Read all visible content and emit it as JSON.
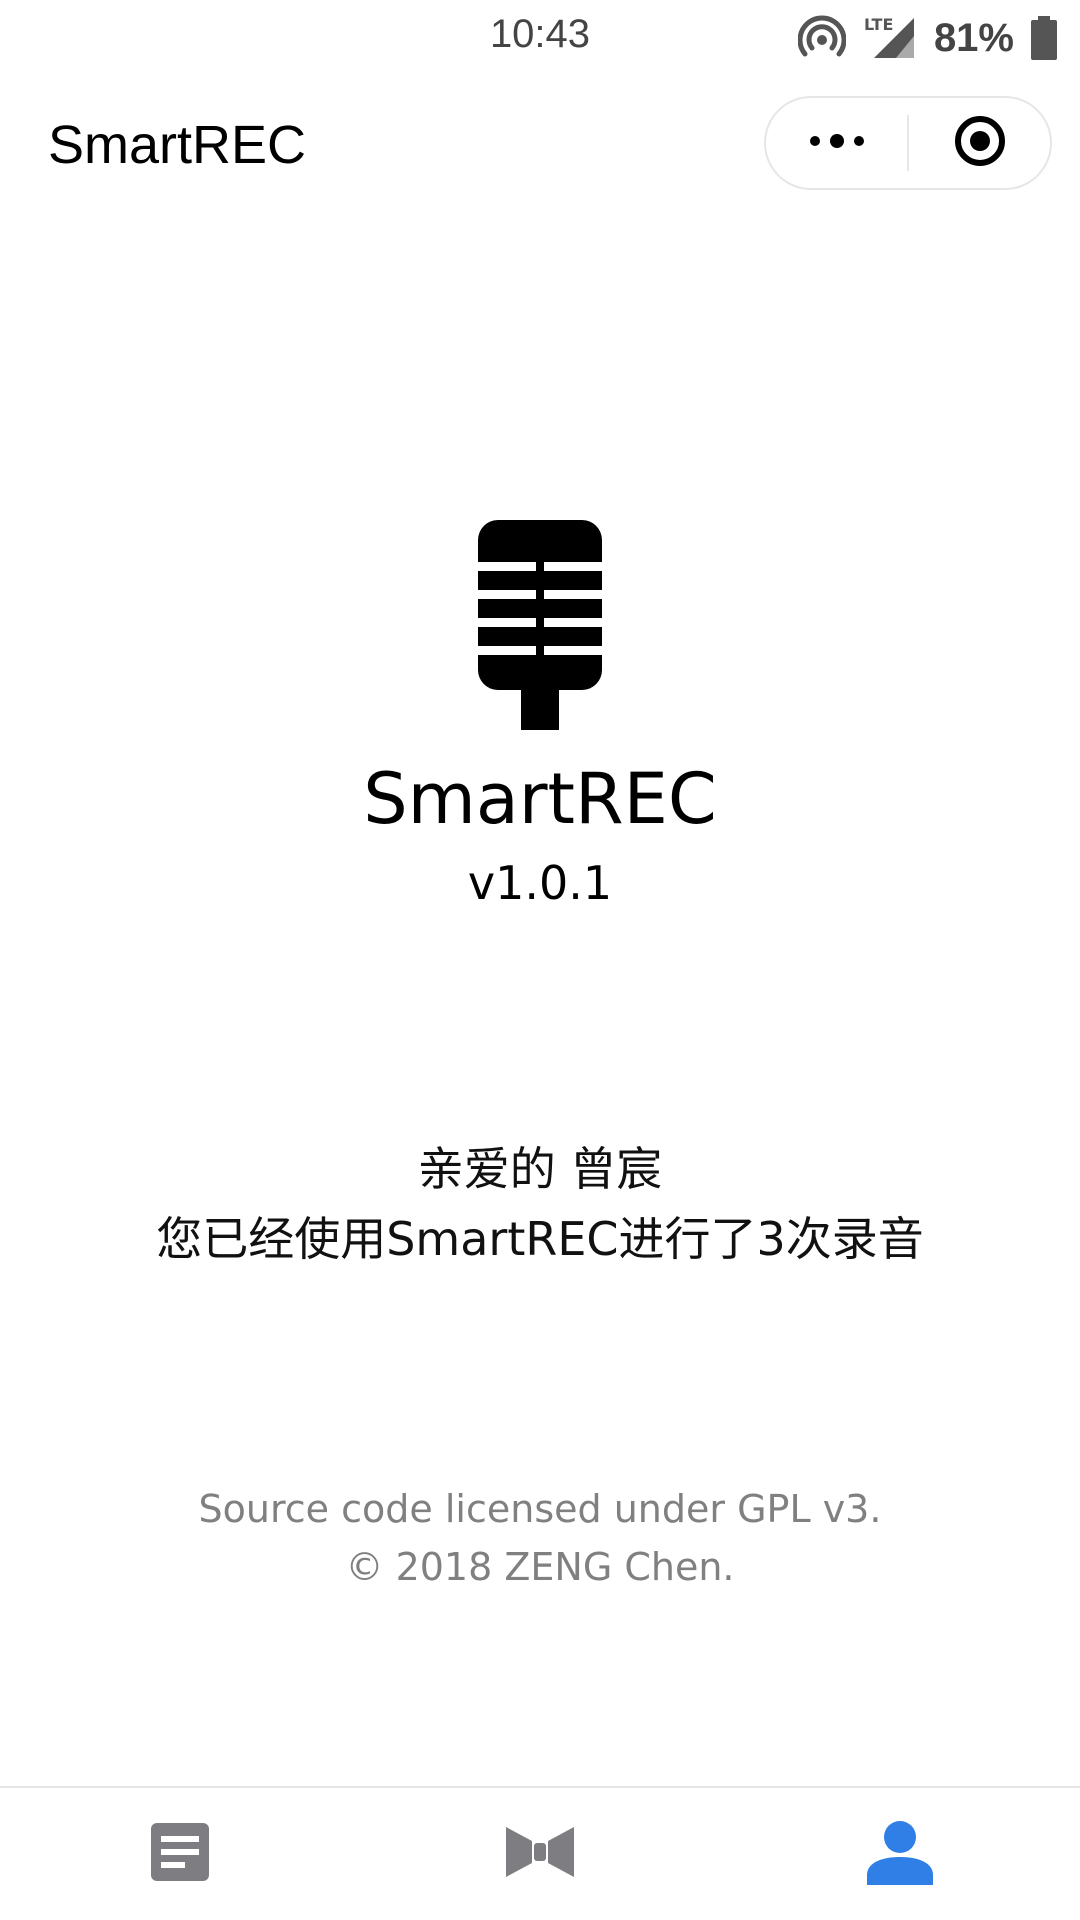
{
  "status_bar": {
    "time": "10:43",
    "network": "LTE",
    "battery_percent": "81%",
    "icons": [
      "hotspot-icon",
      "signal-icon",
      "battery-icon"
    ]
  },
  "nav": {
    "title": "SmartREC",
    "capsule": {
      "more_icon": "more-dots-icon",
      "close_icon": "target-circle-icon"
    }
  },
  "main": {
    "logo_icon": "microphone-icon",
    "app_name": "SmartREC",
    "version": "v1.0.1",
    "greeting_line1": "亲爱的 曾宸",
    "greeting_line2": "您已经使用SmartREC进行了3次录音",
    "license_line": "Source code licensed under GPL v3.",
    "copyright_line": "© 2018 ZENG Chen."
  },
  "tab_bar": {
    "tabs": [
      {
        "icon": "document-list-icon",
        "active": false
      },
      {
        "icon": "bowtie-icon",
        "active": false
      },
      {
        "icon": "person-icon",
        "active": true
      }
    ]
  },
  "colors": {
    "accent": "#2f7fe6",
    "inactive_icon": "#7d7d82",
    "footer_text": "#808080"
  }
}
